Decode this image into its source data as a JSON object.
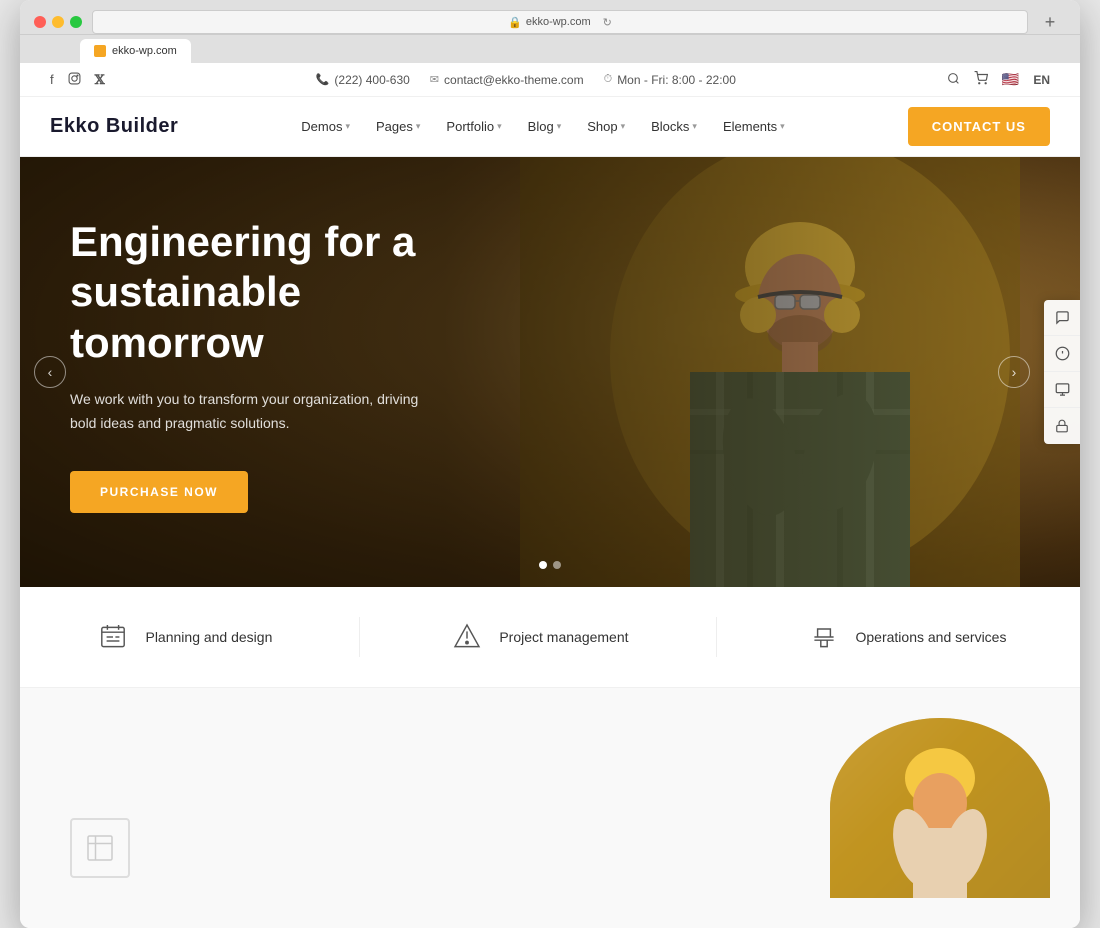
{
  "browser": {
    "url": "ekko-wp.com",
    "refresh_icon": "↻",
    "new_tab_icon": "+",
    "tab_title": "ekko-wp.com"
  },
  "top_bar": {
    "social": {
      "facebook": "f",
      "instagram": "◻",
      "twitter": "t"
    },
    "contact": {
      "phone_icon": "📞",
      "phone": "(222) 400-630",
      "email_icon": "✉",
      "email": "contact@ekko-theme.com",
      "clock_icon": "🕐",
      "hours": "Mon - Fri: 8:00 - 22:00"
    },
    "right": {
      "search_icon": "🔍",
      "cart_icon": "🛒",
      "flag": "🇺🇸",
      "lang": "EN"
    }
  },
  "nav": {
    "logo": "Ekko Builder",
    "menu": [
      {
        "label": "Demos",
        "has_dropdown": true
      },
      {
        "label": "Pages",
        "has_dropdown": true
      },
      {
        "label": "Portfolio",
        "has_dropdown": true
      },
      {
        "label": "Blog",
        "has_dropdown": true
      },
      {
        "label": "Shop",
        "has_dropdown": true
      },
      {
        "label": "Blocks",
        "has_dropdown": true
      },
      {
        "label": "Elements",
        "has_dropdown": true
      }
    ],
    "contact_btn": "Contact US"
  },
  "hero": {
    "title": "Engineering for a sustainable tomorrow",
    "subtitle": "We work with you to transform your organization, driving bold ideas and pragmatic solutions.",
    "cta_btn": "Purchase Now",
    "arrow_left": "‹",
    "arrow_right": "›",
    "dots": [
      {
        "active": true
      },
      {
        "active": false
      }
    ]
  },
  "side_widgets": [
    {
      "icon": "💬",
      "name": "chat-widget"
    },
    {
      "icon": "ℹ",
      "name": "info-widget"
    },
    {
      "icon": "▶",
      "name": "play-widget"
    },
    {
      "icon": "🔒",
      "name": "lock-widget"
    }
  ],
  "features": [
    {
      "icon": "⊞",
      "label": "Planning and design"
    },
    {
      "icon": "△",
      "label": "Project management"
    },
    {
      "icon": "⚖",
      "label": "Operations and services"
    }
  ]
}
